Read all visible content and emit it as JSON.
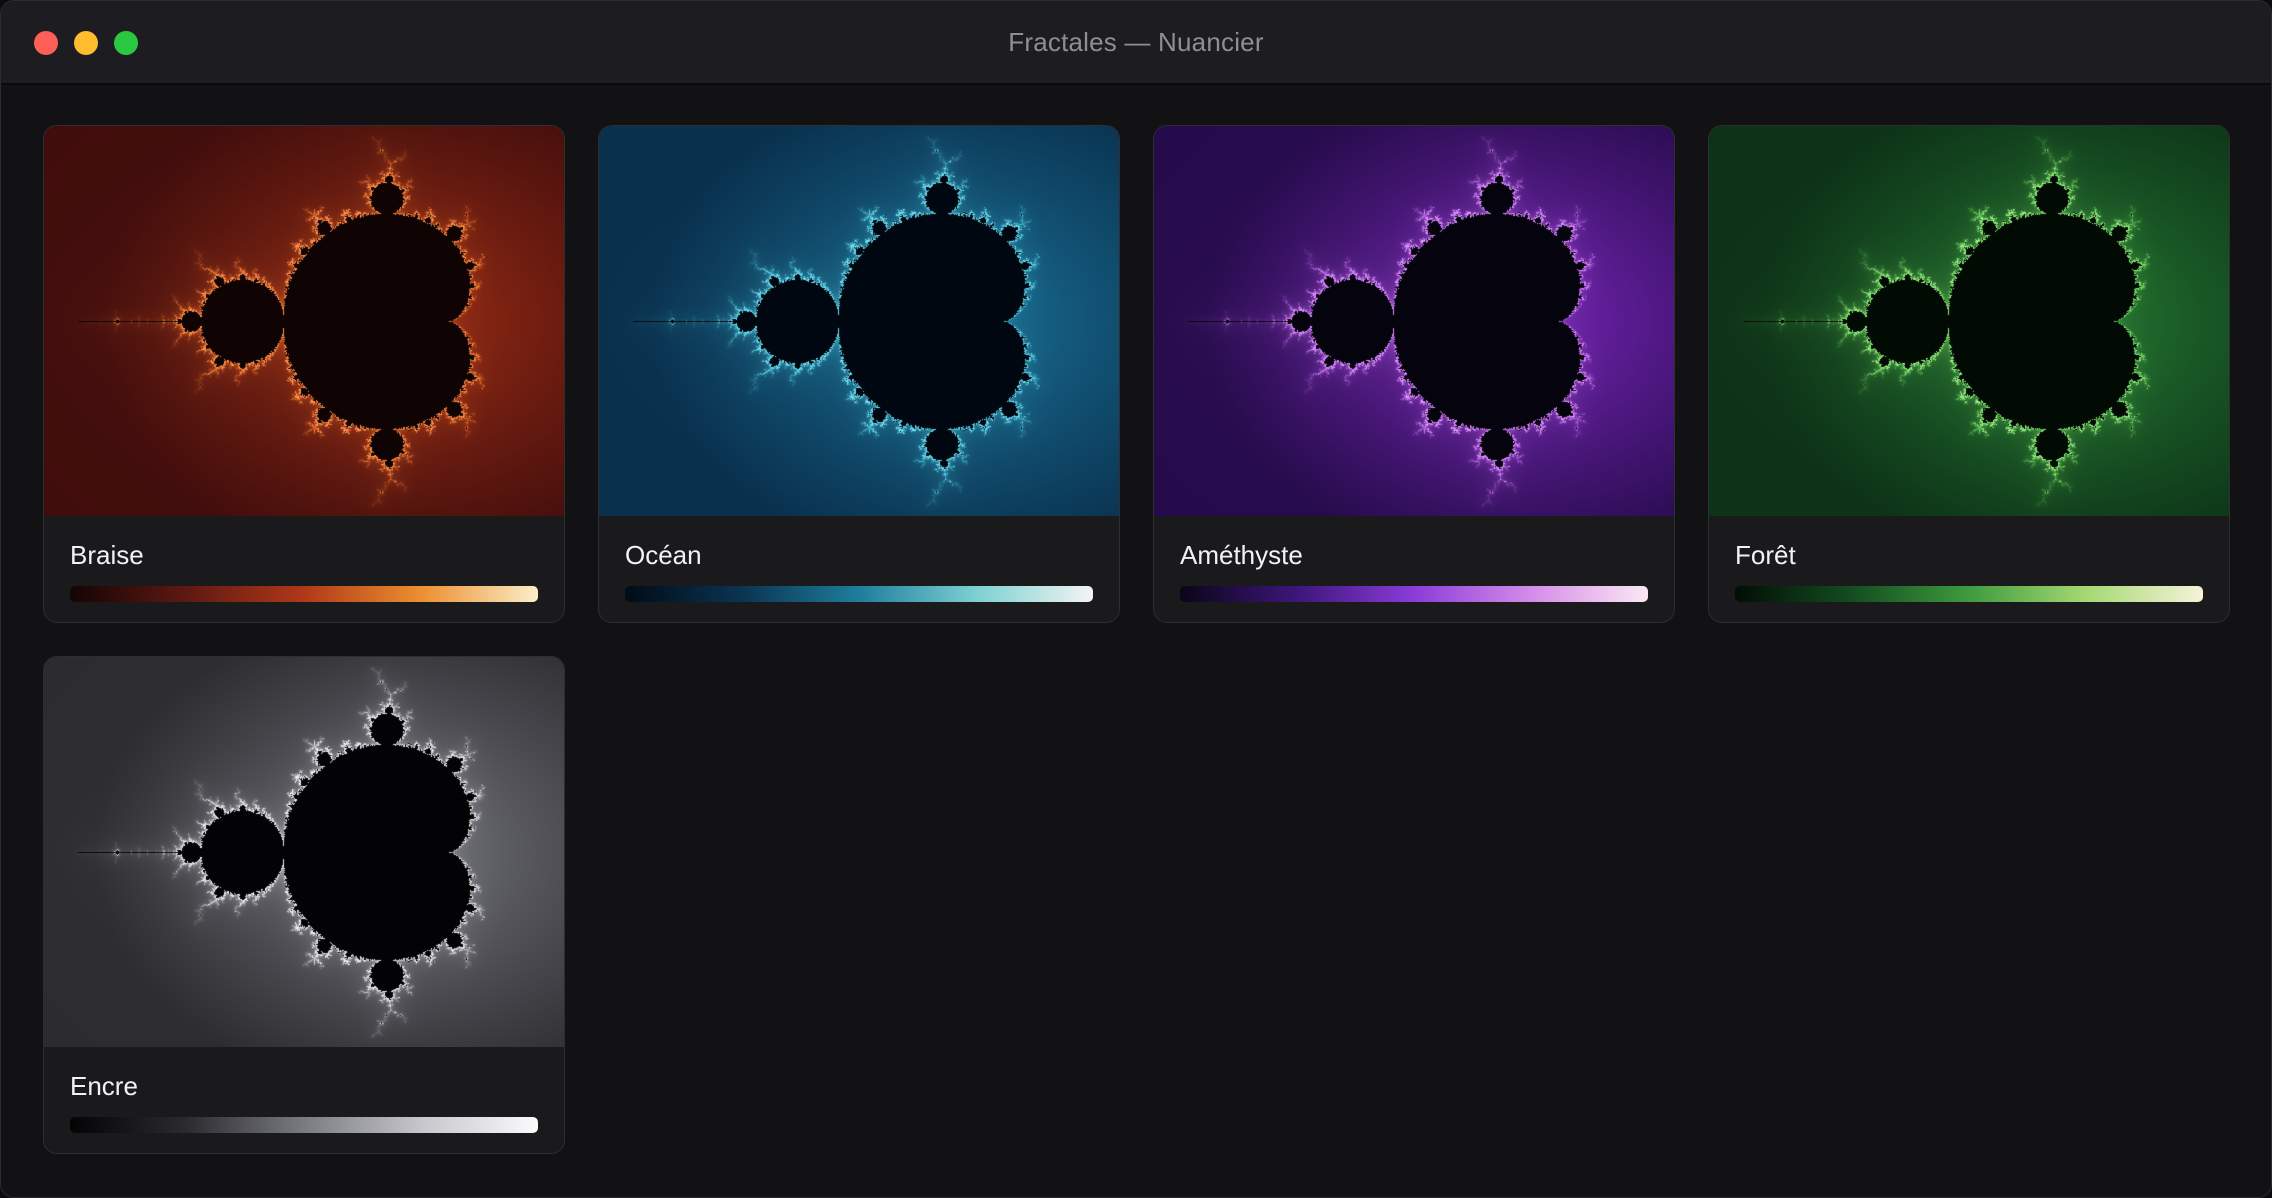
{
  "window": {
    "title": "Fractales — Nuancier"
  },
  "palettes": [
    {
      "name": "Braise",
      "bg_outer": "#3f0c0c",
      "bg_inner": "#8a2512",
      "glow": "#ff7a2a",
      "body": "#0f0304",
      "ramp": [
        "#140405",
        "#5e1912",
        "#b03818",
        "#ec8f30",
        "#fbeec7"
      ]
    },
    {
      "name": "Océan",
      "bg_outer": "#082e4b",
      "bg_inner": "#15648a",
      "glow": "#53d6ec",
      "body": "#010711",
      "ramp": [
        "#020b17",
        "#0a3452",
        "#1f7d9c",
        "#7cd0d2",
        "#f3f4f2"
      ]
    },
    {
      "name": "Améthyste",
      "bg_outer": "#240a4a",
      "bg_inner": "#6a1fa8",
      "glow": "#d679ff",
      "body": "#05030e",
      "ramp": [
        "#0a0518",
        "#3c167a",
        "#8b3bd9",
        "#d48ce8",
        "#fbe8f3"
      ]
    },
    {
      "name": "Forêt",
      "bg_outer": "#0b3016",
      "bg_inner": "#1d6a2c",
      "glow": "#7ee866",
      "body": "#020a04",
      "ramp": [
        "#030d05",
        "#134d21",
        "#3f9a3e",
        "#a5d873",
        "#f7f2da"
      ]
    },
    {
      "name": "Encre",
      "bg_outer": "#2a2a2e",
      "bg_inner": "#67676f",
      "glow": "#e6e6ec",
      "body": "#030305",
      "ramp": [
        "#040405",
        "#2b2b30",
        "#7a7a82",
        "#c6c6cc",
        "#fbfbfc"
      ]
    }
  ]
}
